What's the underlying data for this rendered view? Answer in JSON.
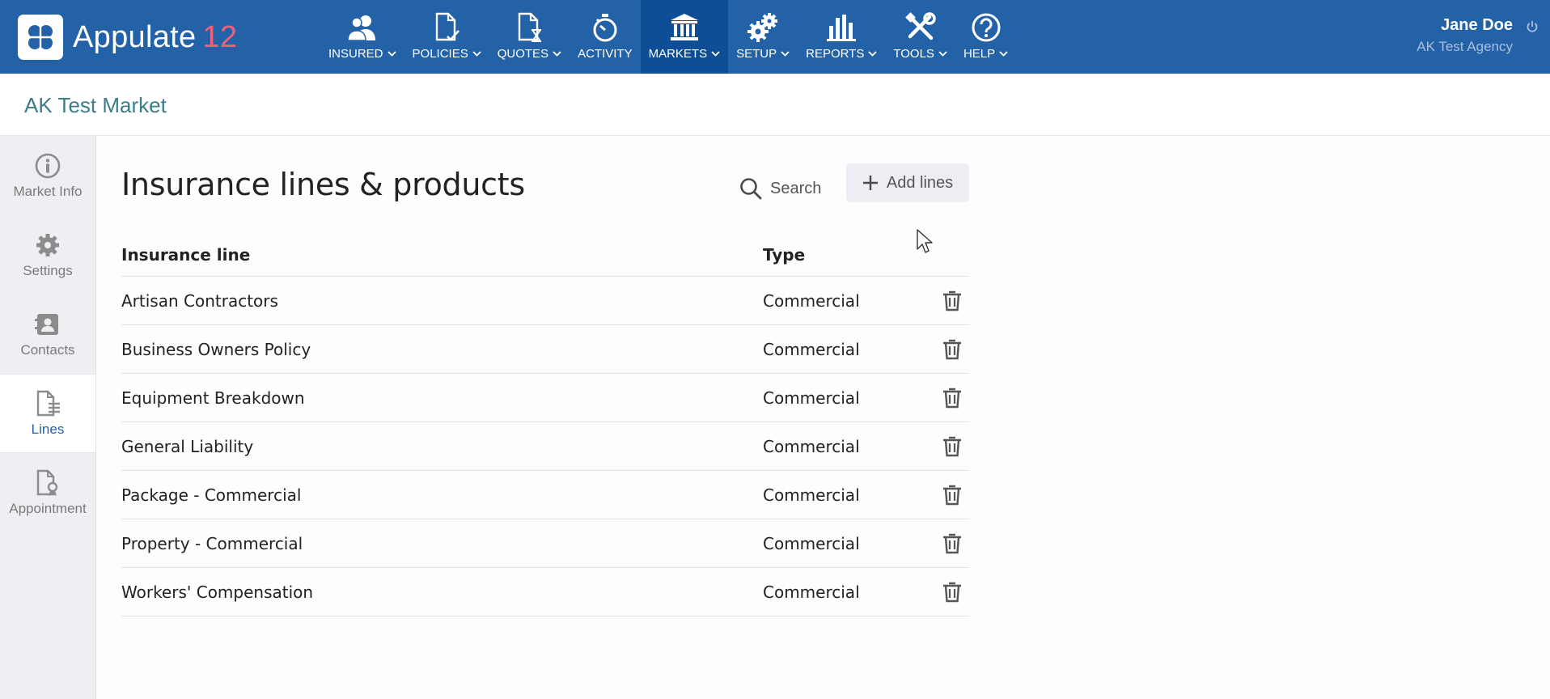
{
  "app": {
    "name": "Appulate",
    "version": "12"
  },
  "nav": [
    {
      "key": "insured",
      "label": "INSURED",
      "icon": "users-icon",
      "chevron": true
    },
    {
      "key": "policies",
      "label": "POLICIES",
      "icon": "policy-doc-icon",
      "chevron": true
    },
    {
      "key": "quotes",
      "label": "QUOTES",
      "icon": "quote-doc-icon",
      "chevron": true
    },
    {
      "key": "activity",
      "label": "ACTIVITY",
      "icon": "stopwatch-icon",
      "chevron": false
    },
    {
      "key": "markets",
      "label": "MARKETS",
      "icon": "bank-icon",
      "chevron": true,
      "active": true
    },
    {
      "key": "setup",
      "label": "SETUP",
      "icon": "gears-icon",
      "chevron": true
    },
    {
      "key": "reports",
      "label": "REPORTS",
      "icon": "bar-chart-icon",
      "chevron": true
    },
    {
      "key": "tools",
      "label": "TOOLS",
      "icon": "tools-icon",
      "chevron": true
    },
    {
      "key": "help",
      "label": "HELP",
      "icon": "question-icon",
      "chevron": true
    }
  ],
  "user": {
    "name": "Jane Doe",
    "agency": "AK Test Agency"
  },
  "market": {
    "title": "AK Test Market"
  },
  "sidebar": {
    "items": [
      {
        "label": "Market Info",
        "icon": "info-icon"
      },
      {
        "label": "Settings",
        "icon": "gear-icon"
      },
      {
        "label": "Contacts",
        "icon": "contacts-icon"
      },
      {
        "label": "Lines",
        "icon": "lines-doc-icon",
        "active": true
      },
      {
        "label": "Appointment",
        "icon": "certificate-icon"
      }
    ]
  },
  "main": {
    "title": "Insurance lines & products",
    "search_label": "Search",
    "add_label": "Add lines",
    "columns": {
      "line": "Insurance line",
      "type": "Type"
    },
    "rows": [
      {
        "line": "Artisan Contractors",
        "type": "Commercial"
      },
      {
        "line": "Business Owners Policy",
        "type": "Commercial"
      },
      {
        "line": "Equipment Breakdown",
        "type": "Commercial"
      },
      {
        "line": "General Liability",
        "type": "Commercial"
      },
      {
        "line": "Package - Commercial",
        "type": "Commercial"
      },
      {
        "line": "Property - Commercial",
        "type": "Commercial"
      },
      {
        "line": "Workers' Compensation",
        "type": "Commercial"
      }
    ]
  },
  "colors": {
    "nav_bg": "#2462a8",
    "nav_active": "#0e4e96",
    "accent_version": "#f0607a",
    "market_title": "#3c7d8c"
  }
}
